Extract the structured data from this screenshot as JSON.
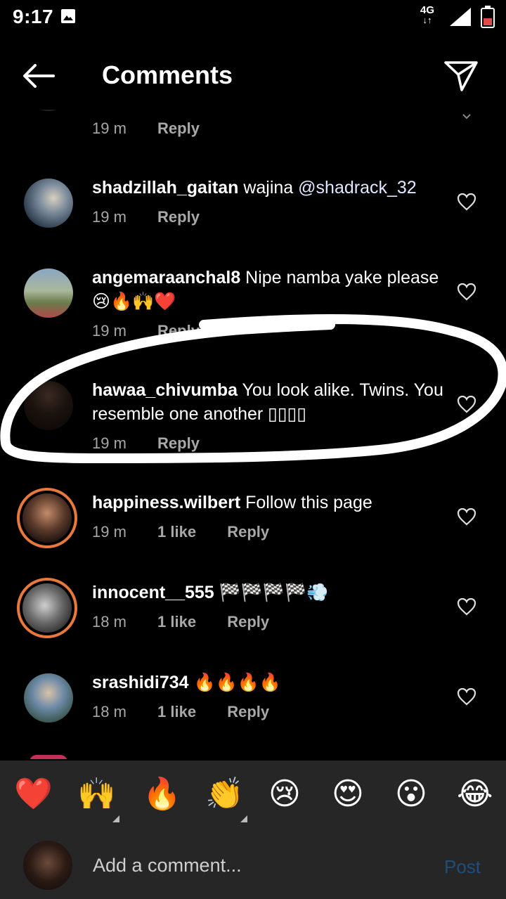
{
  "status": {
    "time": "9:17",
    "network": "4G"
  },
  "header": {
    "title": "Comments"
  },
  "comments": [
    {
      "username": "",
      "text": "",
      "time": "19 m",
      "likes": "",
      "reply": "Reply"
    },
    {
      "username": "shadzillah_gaitan",
      "text": " wajina ",
      "mention": "@shadrack_32",
      "time": "19 m",
      "likes": "",
      "reply": "Reply"
    },
    {
      "username": "angemaraanchal8",
      "text": " Nipe namba yake please😢🔥🙌❤️",
      "time": "19 m",
      "likes": "",
      "reply": "Reply"
    },
    {
      "username": "hawaa_chivumba",
      "text": " You look alike. Twins. You resemble one another ▯▯▯▯",
      "time": "19 m",
      "likes": "",
      "reply": "Reply"
    },
    {
      "username": "happiness.wilbert",
      "text": " Follow this page",
      "time": "19 m",
      "likes": "1 like",
      "reply": "Reply"
    },
    {
      "username": "innocent__555",
      "text": " 🏁🏁🏁🏁💨",
      "time": "18 m",
      "likes": "1 like",
      "reply": "Reply"
    },
    {
      "username": "srashidi734",
      "text": " 🔥🔥🔥🔥",
      "time": "18 m",
      "likes": "1 like",
      "reply": "Reply"
    }
  ],
  "reactions": [
    "❤️",
    "🙌",
    "🔥",
    "👏",
    "😢",
    "😍",
    "😮",
    "😂"
  ],
  "composer": {
    "placeholder": "Add a comment...",
    "post_label": "Post"
  },
  "colors": {
    "background": "#000000",
    "panel": "#262626",
    "meta": "#a8a8a8",
    "story_ring": "#e8793b",
    "post_disabled": "#1e4e7a"
  },
  "icons": [
    "image-icon",
    "signal-icon",
    "battery-icon",
    "back-arrow-icon",
    "send-icon",
    "heart-outline-icon"
  ]
}
